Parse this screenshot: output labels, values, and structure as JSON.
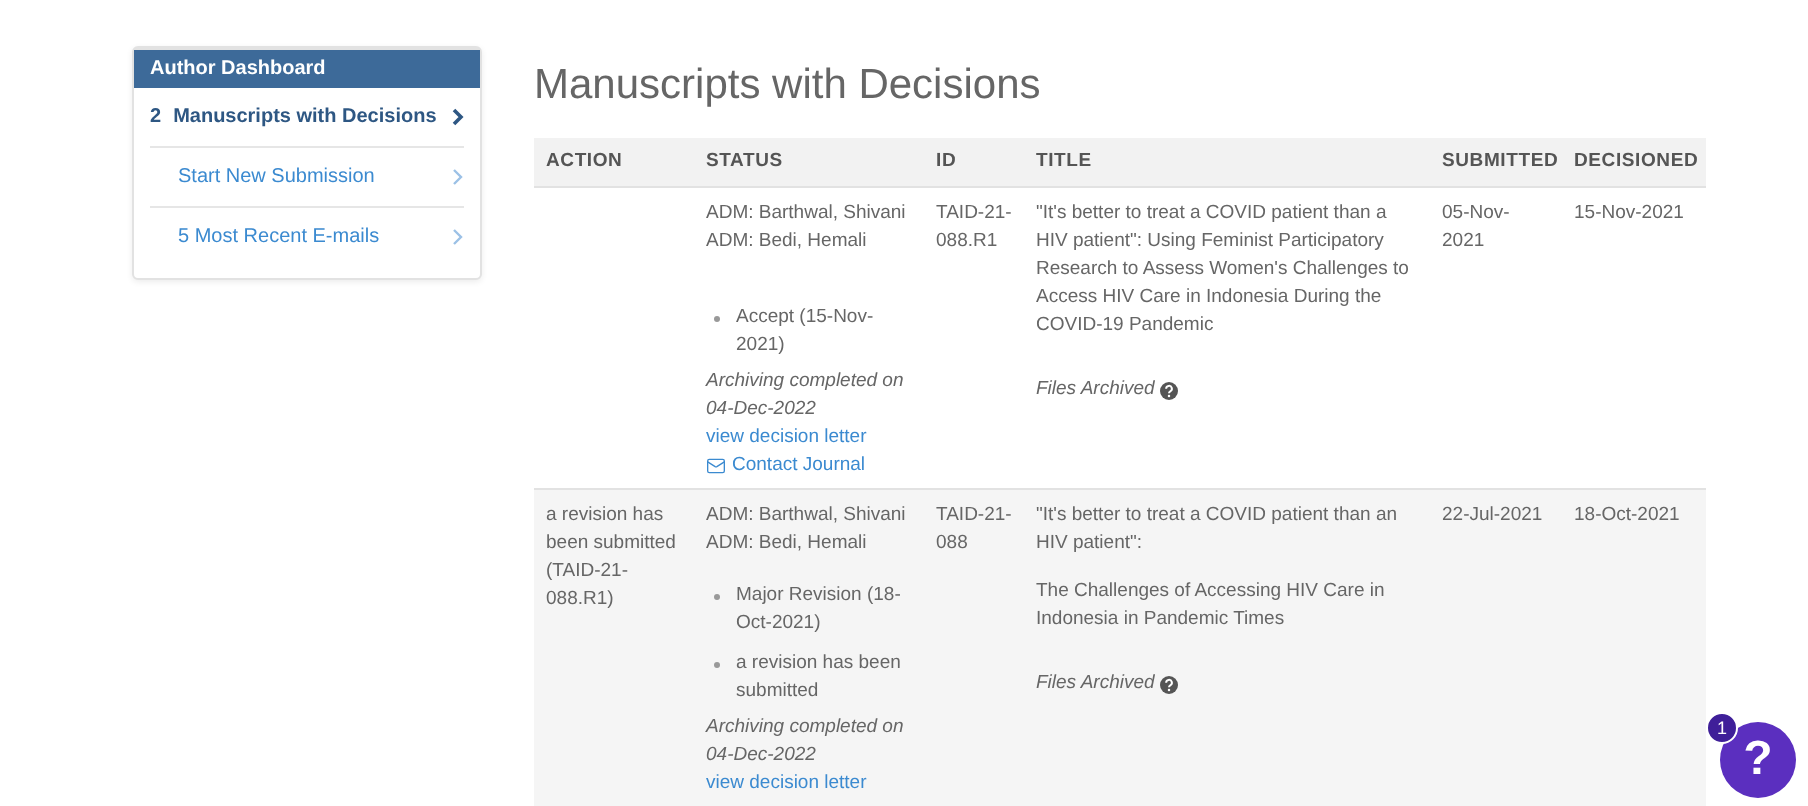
{
  "sidebar": {
    "title": "Author Dashboard",
    "items": [
      {
        "count": "2",
        "label": "Manuscripts with Decisions",
        "selected": true
      },
      {
        "label": "Start New Submission",
        "selected": false
      },
      {
        "label": "5 Most Recent E-mails",
        "selected": false
      }
    ]
  },
  "page_title": "Manuscripts with Decisions",
  "table": {
    "columns": [
      "ACTION",
      "STATUS",
      "ID",
      "TITLE",
      "SUBMITTED",
      "DECISIONED"
    ],
    "rows": [
      {
        "action": "",
        "reviewers": [
          "ADM: Barthwal, Shivani",
          "ADM: Bedi, Hemali"
        ],
        "decisions": [
          "Accept (15-Nov-2021)"
        ],
        "archived": "Archiving completed on 04-Dec-2022",
        "decision_link": "view decision letter",
        "contact_link": "Contact Journal",
        "id": "TAID-21-088.R1",
        "title": [
          "\"It's better to treat a COVID patient than a HIV patient\": Using Feminist Participatory Research to Assess Women's Challenges to Access HIV Care in Indonesia During the COVID-19 Pandemic"
        ],
        "files": "Files Archived",
        "submitted": "05-Nov-2021",
        "decisioned": "15-Nov-2021"
      },
      {
        "action": "a revision has been submitted (TAID-21-088.R1)",
        "reviewers": [
          "ADM: Barthwal, Shivani",
          "ADM: Bedi, Hemali"
        ],
        "decisions": [
          "Major Revision (18-Oct-2021)",
          "a revision has been submitted"
        ],
        "archived": "Archiving completed on 04-Dec-2022",
        "decision_link": "view decision letter",
        "id": "TAID-21-088",
        "title": [
          "\"It's better to treat a COVID patient than an HIV patient\":",
          "The Challenges of Accessing HIV Care in Indonesia in Pandemic Times"
        ],
        "files": "Files Archived",
        "submitted": "22-Jul-2021",
        "decisioned": "18-Oct-2021"
      }
    ]
  },
  "help": {
    "label": "?",
    "badge": "1"
  }
}
